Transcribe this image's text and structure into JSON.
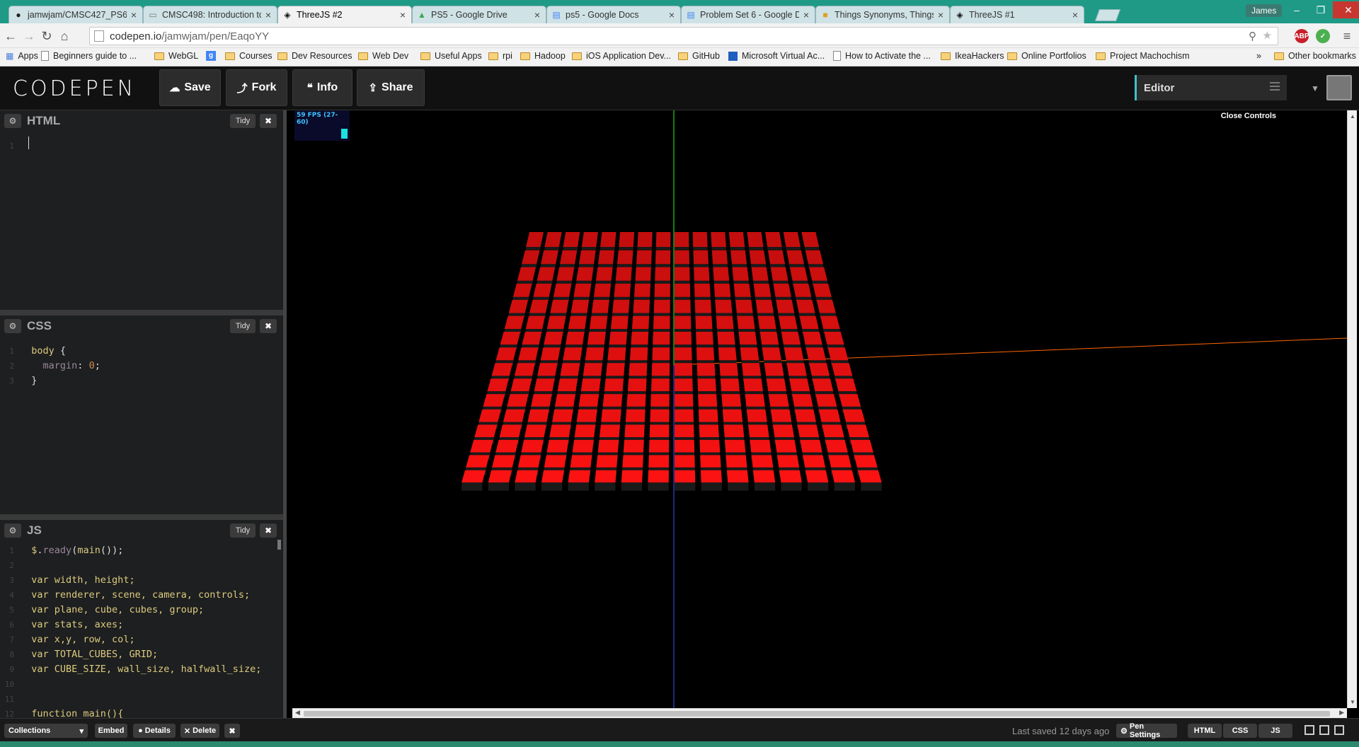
{
  "browser": {
    "tabs": [
      {
        "label": "jamwjam/CMSC427_PS6",
        "icon": "github-icon"
      },
      {
        "label": "CMSC498: Introduction to",
        "icon": "page-icon"
      },
      {
        "label": "ThreeJS #2",
        "icon": "codepen-icon",
        "active": true
      },
      {
        "label": "PS5 - Google Drive",
        "icon": "drive-icon"
      },
      {
        "label": "ps5 - Google Docs",
        "icon": "docs-icon"
      },
      {
        "label": "Problem Set 6 - Google D",
        "icon": "docs-icon"
      },
      {
        "label": "Things Synonyms, Things",
        "icon": "thesaurus-icon"
      },
      {
        "label": "ThreeJS #1",
        "icon": "codepen-icon"
      }
    ],
    "profile_name": "James",
    "url_host": "codepen.io",
    "url_path": "/jamwjam/pen/EaqoYY",
    "extensions": [
      "ABP"
    ],
    "bookmarks": [
      {
        "label": "Apps",
        "icon": "apps-icon"
      },
      {
        "label": "Beginners guide to ...",
        "icon": "page-icon"
      },
      {
        "label": "WebGL",
        "icon": "folder-icon"
      },
      {
        "label": "",
        "icon": "google-icon"
      },
      {
        "label": "Courses",
        "icon": "folder-icon"
      },
      {
        "label": "Dev Resources",
        "icon": "folder-icon"
      },
      {
        "label": "Web Dev",
        "icon": "folder-icon"
      },
      {
        "label": "Useful Apps",
        "icon": "folder-icon"
      },
      {
        "label": "rpi",
        "icon": "folder-icon"
      },
      {
        "label": "Hadoop",
        "icon": "folder-icon"
      },
      {
        "label": "iOS Application Dev...",
        "icon": "folder-icon"
      },
      {
        "label": "GitHub",
        "icon": "folder-icon"
      },
      {
        "label": "Microsoft Virtual Ac...",
        "icon": "mva-icon"
      },
      {
        "label": "How to Activate the ...",
        "icon": "page-icon"
      },
      {
        "label": "IkeaHackers",
        "icon": "folder-icon"
      },
      {
        "label": "Online Portfolios",
        "icon": "folder-icon"
      },
      {
        "label": "Project Machochism",
        "icon": "folder-icon"
      }
    ],
    "bookmarks_overflow": "»",
    "other_bookmarks": "Other bookmarks"
  },
  "codepen": {
    "logo": "CODEPEN",
    "buttons": {
      "save": "Save",
      "fork": "Fork",
      "info": "Info",
      "share": "Share"
    },
    "view": "Editor",
    "accent": "#3ec2c9"
  },
  "editors": {
    "html": {
      "title": "HTML",
      "tidy": "Tidy",
      "lines": [
        "1"
      ]
    },
    "css": {
      "title": "CSS",
      "tidy": "Tidy",
      "lines": [
        {
          "n": "1",
          "parts": [
            {
              "t": "body",
              "c": "sel"
            },
            {
              "t": " {",
              "c": ""
            }
          ]
        },
        {
          "n": "2",
          "parts": [
            {
              "t": "  margin",
              "c": "prop"
            },
            {
              "t": ": ",
              "c": ""
            },
            {
              "t": "0",
              "c": "num"
            },
            {
              "t": ";",
              "c": ""
            }
          ]
        },
        {
          "n": "3",
          "parts": [
            {
              "t": "}",
              "c": ""
            }
          ]
        }
      ]
    },
    "js": {
      "title": "JS",
      "tidy": "Tidy",
      "lines": [
        {
          "n": "1",
          "parts": [
            {
              "t": "$",
              "c": "fn"
            },
            {
              "t": ".",
              "c": ""
            },
            {
              "t": "ready",
              "c": "prop"
            },
            {
              "t": "(",
              "c": ""
            },
            {
              "t": "main",
              "c": "fn"
            },
            {
              "t": "());",
              "c": ""
            }
          ]
        },
        {
          "n": "2",
          "parts": []
        },
        {
          "n": "3",
          "parts": [
            {
              "t": "var ",
              "c": "kw"
            },
            {
              "t": "width, height;",
              "c": "kw"
            }
          ]
        },
        {
          "n": "4",
          "parts": [
            {
              "t": "var ",
              "c": "kw"
            },
            {
              "t": "renderer, scene, camera, controls;",
              "c": "kw"
            }
          ]
        },
        {
          "n": "5",
          "parts": [
            {
              "t": "var ",
              "c": "kw"
            },
            {
              "t": "plane, cube, cubes, group;",
              "c": "kw"
            }
          ]
        },
        {
          "n": "6",
          "parts": [
            {
              "t": "var ",
              "c": "kw"
            },
            {
              "t": "stats, axes;",
              "c": "kw"
            }
          ]
        },
        {
          "n": "7",
          "parts": [
            {
              "t": "var ",
              "c": "kw"
            },
            {
              "t": "x,y, row, col;",
              "c": "kw"
            }
          ]
        },
        {
          "n": "8",
          "parts": [
            {
              "t": "var ",
              "c": "kw"
            },
            {
              "t": "TOTAL_CUBES, GRID;",
              "c": "kw"
            }
          ]
        },
        {
          "n": "9",
          "parts": [
            {
              "t": "var ",
              "c": "kw"
            },
            {
              "t": "CUBE_SIZE, wall_size, halfwall_size;",
              "c": "kw"
            }
          ]
        },
        {
          "n": "10",
          "parts": []
        },
        {
          "n": "11",
          "parts": []
        },
        {
          "n": "12",
          "parts": [
            {
              "t": "function ",
              "c": "kw"
            },
            {
              "t": "main(){",
              "c": "kw"
            }
          ]
        }
      ]
    }
  },
  "preview": {
    "fps_label": "59 FPS (27-60)",
    "close_controls": "Close Controls",
    "grid": {
      "rows": 16,
      "cols": 16,
      "cube_color": "#ee1111"
    },
    "axes": {
      "x_color": "#ff6600",
      "y_color": "#22ff22",
      "z_color": "#3355ff"
    }
  },
  "footer": {
    "collections": "Collections",
    "embed": "Embed",
    "details": "Details",
    "delete": "Delete",
    "last_saved": "Last saved 12 days ago",
    "pen_settings": "Pen Settings",
    "views": [
      "HTML",
      "CSS",
      "JS"
    ]
  }
}
